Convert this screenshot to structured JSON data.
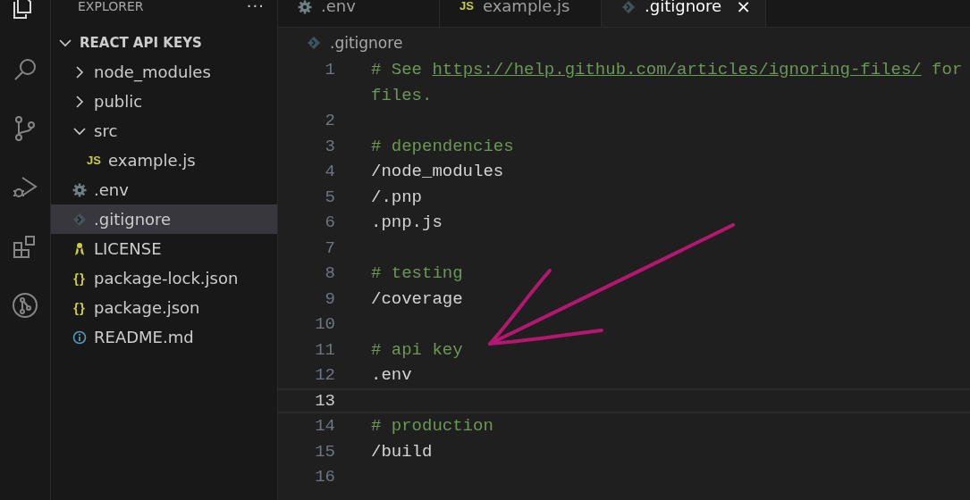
{
  "explorer": {
    "title": "EXPLORER",
    "more": "···",
    "tree": {
      "label": "REACT API KEYS",
      "expanded": true,
      "children": [
        {
          "label": "node_modules",
          "kind": "folder",
          "expanded": false,
          "selected": false
        },
        {
          "label": "public",
          "kind": "folder",
          "expanded": false,
          "selected": false
        },
        {
          "label": "src",
          "kind": "folder",
          "expanded": true,
          "selected": false,
          "children": [
            {
              "label": "example.js",
              "kind": "js",
              "icon": "JS",
              "selected": false
            }
          ]
        },
        {
          "label": ".env",
          "kind": "config",
          "selected": false
        },
        {
          "label": ".gitignore",
          "kind": "git",
          "selected": true
        },
        {
          "label": "LICENSE",
          "kind": "license",
          "selected": false
        },
        {
          "label": "package-lock.json",
          "kind": "json",
          "icon": "{}",
          "selected": false
        },
        {
          "label": "package.json",
          "kind": "json",
          "icon": "{}",
          "selected": false
        },
        {
          "label": "README.md",
          "kind": "info",
          "selected": false
        }
      ]
    }
  },
  "tabs": [
    {
      "label": ".env",
      "kind": "config",
      "selected": false
    },
    {
      "label": "example.js",
      "kind": "js",
      "icon": "JS",
      "selected": false
    },
    {
      "label": ".gitignore",
      "kind": "git",
      "selected": true,
      "close": "×"
    }
  ],
  "breadcrumb": {
    "label": ".gitignore",
    "kind": "git"
  },
  "editor": {
    "lines": [
      {
        "number": "1",
        "current": false,
        "segments": [
          {
            "kind": "comment",
            "text": "# See "
          },
          {
            "kind": "link",
            "text": "https://help.github.com/articles/ignoring-files/"
          },
          {
            "kind": "comment",
            "text": " for"
          }
        ],
        "wrap": [
          {
            "kind": "comment",
            "text": "files."
          }
        ]
      },
      {
        "number": "2",
        "current": false
      },
      {
        "number": "3",
        "current": false,
        "segments": [
          {
            "kind": "comment",
            "text": "# dependencies"
          }
        ]
      },
      {
        "number": "4",
        "current": false,
        "segments": [
          {
            "kind": "text",
            "text": "/node_modules"
          }
        ]
      },
      {
        "number": "5",
        "current": false,
        "segments": [
          {
            "kind": "text",
            "text": "/.pnp"
          }
        ]
      },
      {
        "number": "6",
        "current": false,
        "segments": [
          {
            "kind": "text",
            "text": ".pnp.js"
          }
        ]
      },
      {
        "number": "7",
        "current": false
      },
      {
        "number": "8",
        "current": false,
        "segments": [
          {
            "kind": "comment",
            "text": "# testing"
          }
        ]
      },
      {
        "number": "9",
        "current": false,
        "segments": [
          {
            "kind": "text",
            "text": "/coverage"
          }
        ]
      },
      {
        "number": "10",
        "current": false
      },
      {
        "number": "11",
        "current": false,
        "segments": [
          {
            "kind": "comment",
            "text": "# api key"
          }
        ]
      },
      {
        "number": "12",
        "current": false,
        "segments": [
          {
            "kind": "text",
            "text": ".env"
          }
        ]
      },
      {
        "number": "13",
        "current": true
      },
      {
        "number": "14",
        "current": false,
        "segments": [
          {
            "kind": "comment",
            "text": "# production"
          }
        ]
      },
      {
        "number": "15",
        "current": false,
        "segments": [
          {
            "kind": "text",
            "text": "/build"
          }
        ]
      },
      {
        "number": "16",
        "current": false
      }
    ]
  }
}
